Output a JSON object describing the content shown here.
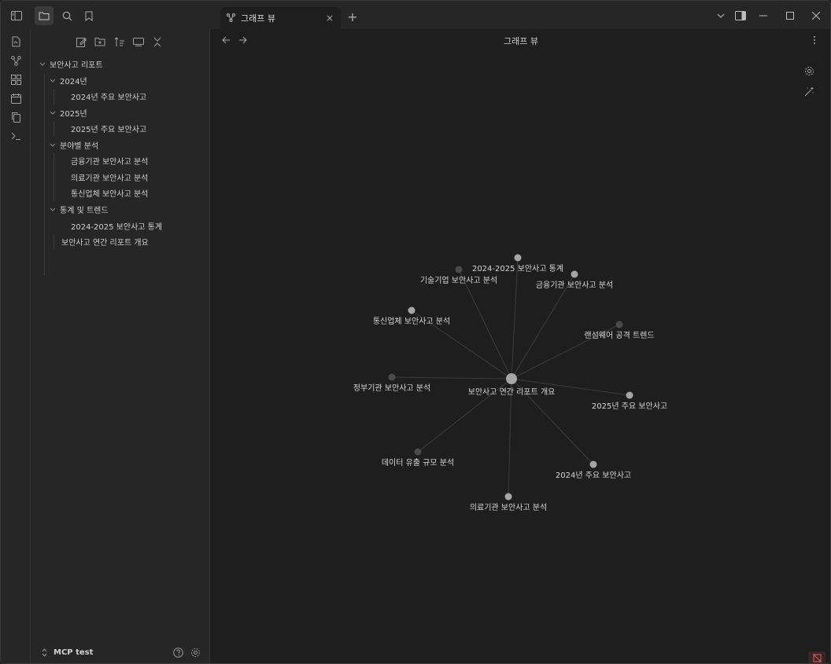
{
  "titlebar": {
    "tab_label": "그래프 뷰",
    "new_tab": "+",
    "close": "×"
  },
  "sidebar": {
    "footer_vault": "MCP test",
    "tree": [
      {
        "label": "보안사고 리포트"
      },
      {
        "label": "2024년"
      },
      {
        "label": "2024년 주요 보안사고"
      },
      {
        "label": "2025년"
      },
      {
        "label": "2025년 주요 보안사고"
      },
      {
        "label": "분야별 분석"
      },
      {
        "label": "금융기관 보안사고 분석"
      },
      {
        "label": "의료기관 보안사고 분석"
      },
      {
        "label": "통신업체 보안사고 분석"
      },
      {
        "label": "통계 및 트렌드"
      },
      {
        "label": "2024-2025 보안사고 통계"
      },
      {
        "label": "보안사고 연간 리포트 개요"
      }
    ]
  },
  "main": {
    "view_title": "그래프 뷰"
  },
  "graph": {
    "center": {
      "label": "보안사고 연간 리포트 개요",
      "color": "#a6a6a6"
    },
    "nodes": [
      {
        "label": "2024-2025 보안사고 통계",
        "color": "#a6a6a6"
      },
      {
        "label": "기술기업 보안사고 분석",
        "color": "#4a4a4a"
      },
      {
        "label": "금융기관 보안사고 분석",
        "color": "#a6a6a6"
      },
      {
        "label": "통신업체 보안사고 분석",
        "color": "#a6a6a6"
      },
      {
        "label": "랜섬웨어 공격 트렌드",
        "color": "#4a4a4a"
      },
      {
        "label": "정부기관 보안사고 분석",
        "color": "#4a4a4a"
      },
      {
        "label": "2025년 주요 보안사고",
        "color": "#a6a6a6"
      },
      {
        "label": "데이터 유출 규모 분석",
        "color": "#4a4a4a"
      },
      {
        "label": "2024년 주요 보안사고",
        "color": "#a6a6a6"
      },
      {
        "label": "의료기관 보안사고 분석",
        "color": "#a6a6a6"
      }
    ]
  }
}
